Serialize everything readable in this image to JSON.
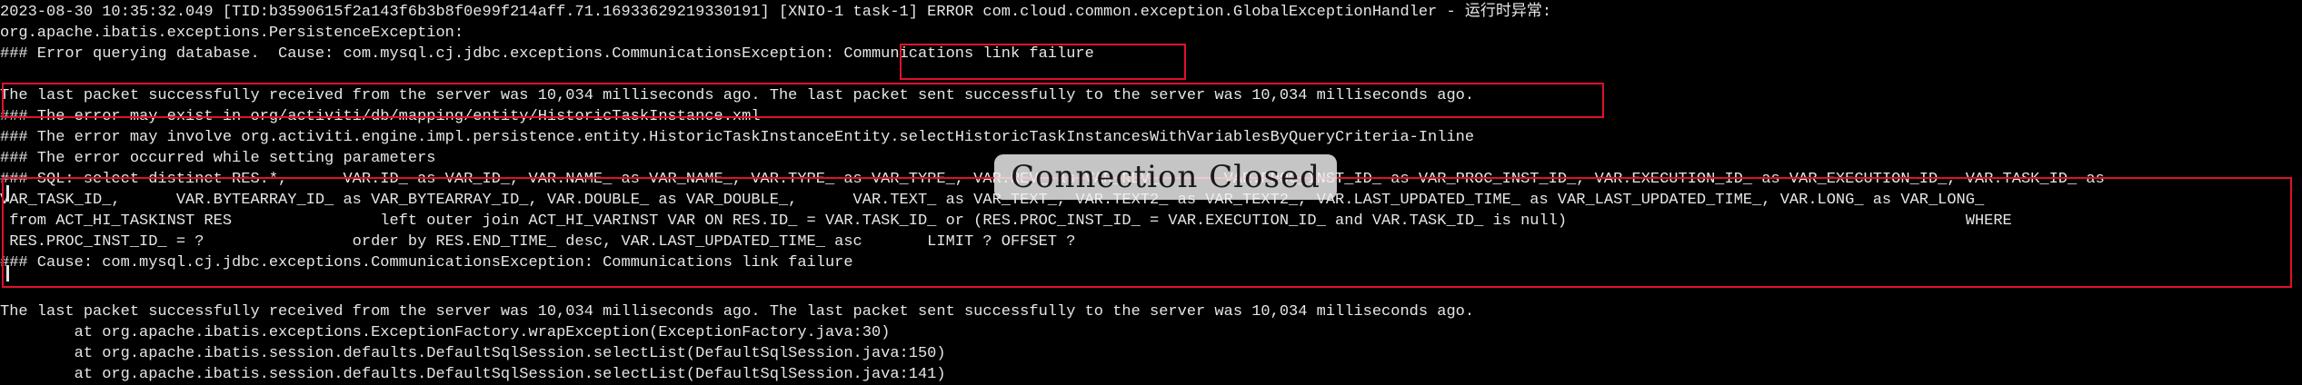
{
  "colors": {
    "background": "#000000",
    "text": "#e6e6e6",
    "highlight_border": "#e0112b",
    "overlay_background": "#f0f0f0"
  },
  "terminal": {
    "lines": [
      "2023-08-30 10:35:32.049 [TID:b3590615f2a143f6b3b8f0e99f214aff.71.16933629219330191] [XNIO-1 task-1] ERROR com.cloud.common.exception.GlobalExceptionHandler - 运行时异常:",
      "org.apache.ibatis.exceptions.PersistenceException:",
      "### Error querying database.  Cause: com.mysql.cj.jdbc.exceptions.CommunicationsException: Communications link failure",
      "",
      "The last packet successfully received from the server was 10,034 milliseconds ago. The last packet sent successfully to the server was 10,034 milliseconds ago.",
      "### The error may exist in org/activiti/db/mapping/entity/HistoricTaskInstance.xml",
      "### The error may involve org.activiti.engine.impl.persistence.entity.HistoricTaskInstanceEntity.selectHistoricTaskInstancesWithVariablesByQueryCriteria-Inline",
      "### The error occurred while setting parameters",
      "### SQL: select distinct RES.*,      VAR.ID_ as VAR_ID_, VAR.NAME_ as VAR_NAME_, VAR.TYPE_ as VAR_TYPE_, VAR.REV_ as VAR_REV_,      VAR.PROC_INST_ID_ as VAR_PROC_INST_ID_, VAR.EXECUTION_ID_ as VAR_EXECUTION_ID_, VAR.TASK_ID_ as",
      "VAR_TASK_ID_,      VAR.BYTEARRAY_ID_ as VAR_BYTEARRAY_ID_, VAR.DOUBLE_ as VAR_DOUBLE_,      VAR.TEXT_ as VAR_TEXT_, VAR.TEXT2_ as VAR_TEXT2_, VAR.LAST_UPDATED_TIME_ as VAR_LAST_UPDATED_TIME_, VAR.LONG_ as VAR_LONG_",
      " from ACT_HI_TASKINST RES                left outer join ACT_HI_VARINST VAR ON RES.ID_ = VAR.TASK_ID_ or (RES.PROC_INST_ID_ = VAR.EXECUTION_ID_ and VAR.TASK_ID_ is null)                                           WHERE",
      " RES.PROC_INST_ID_ = ?                order by RES.END_TIME_ desc, VAR.LAST_UPDATED_TIME_ asc       LIMIT ? OFFSET ?",
      "### Cause: com.mysql.cj.jdbc.exceptions.CommunicationsException: Communications link failure",
      "",
      "The last packet successfully received from the server was 10,034 milliseconds ago. The last packet sent successfully to the server was 10,034 milliseconds ago.",
      "        at org.apache.ibatis.exceptions.ExceptionFactory.wrapException(ExceptionFactory.java:30)",
      "        at org.apache.ibatis.session.defaults.DefaultSqlSession.selectList(DefaultSqlSession.java:150)",
      "        at org.apache.ibatis.session.defaults.DefaultSqlSession.selectList(DefaultSqlSession.java:141)"
    ]
  },
  "overlay": {
    "label": "Connection Closed"
  }
}
